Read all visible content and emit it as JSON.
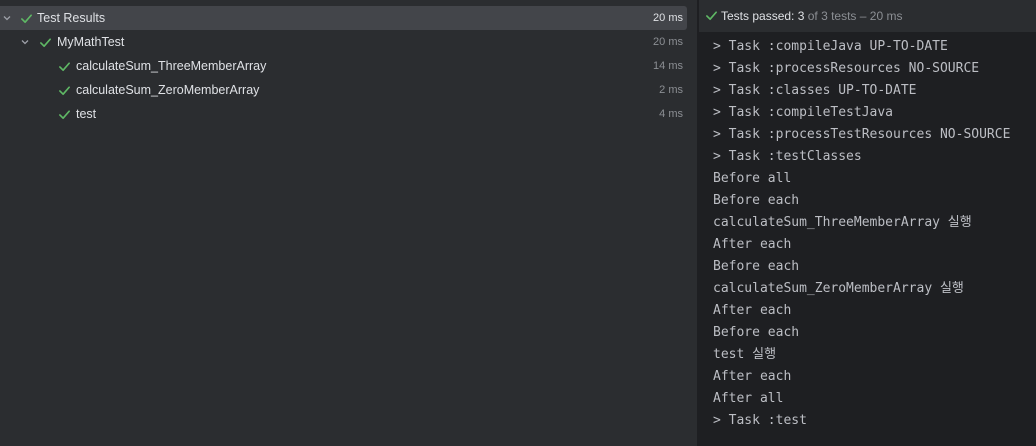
{
  "colors": {
    "pass": "#5fb865",
    "selected_row": "#43454a",
    "panel_bg": "#2b2d30",
    "console_bg": "#1e1f22"
  },
  "tree": {
    "root": {
      "label": "Test Results",
      "duration": "20 ms",
      "status_icon": "check-icon",
      "expanded": true
    },
    "suite": {
      "label": "MyMathTest",
      "duration": "20 ms",
      "status_icon": "check-icon",
      "expanded": true
    },
    "tests": [
      {
        "label": "calculateSum_ThreeMemberArray",
        "duration": "14 ms",
        "status_icon": "check-icon"
      },
      {
        "label": "calculateSum_ZeroMemberArray",
        "duration": "2 ms",
        "status_icon": "check-icon"
      },
      {
        "label": "test",
        "duration": "4 ms",
        "status_icon": "check-icon"
      }
    ]
  },
  "console": {
    "status": {
      "prefix": "Tests passed: ",
      "passed": "3",
      "rest": " of 3 tests – 20 ms"
    },
    "lines": [
      "> Task :compileJava UP-TO-DATE",
      "> Task :processResources NO-SOURCE",
      "> Task :classes UP-TO-DATE",
      "> Task :compileTestJava",
      "> Task :processTestResources NO-SOURCE",
      "> Task :testClasses",
      "Before all",
      "Before each",
      "calculateSum_ThreeMemberArray 실행",
      "After each",
      "Before each",
      "calculateSum_ZeroMemberArray 실행",
      "After each",
      "Before each",
      "test 실행",
      "After each",
      "After all",
      "> Task :test"
    ]
  }
}
